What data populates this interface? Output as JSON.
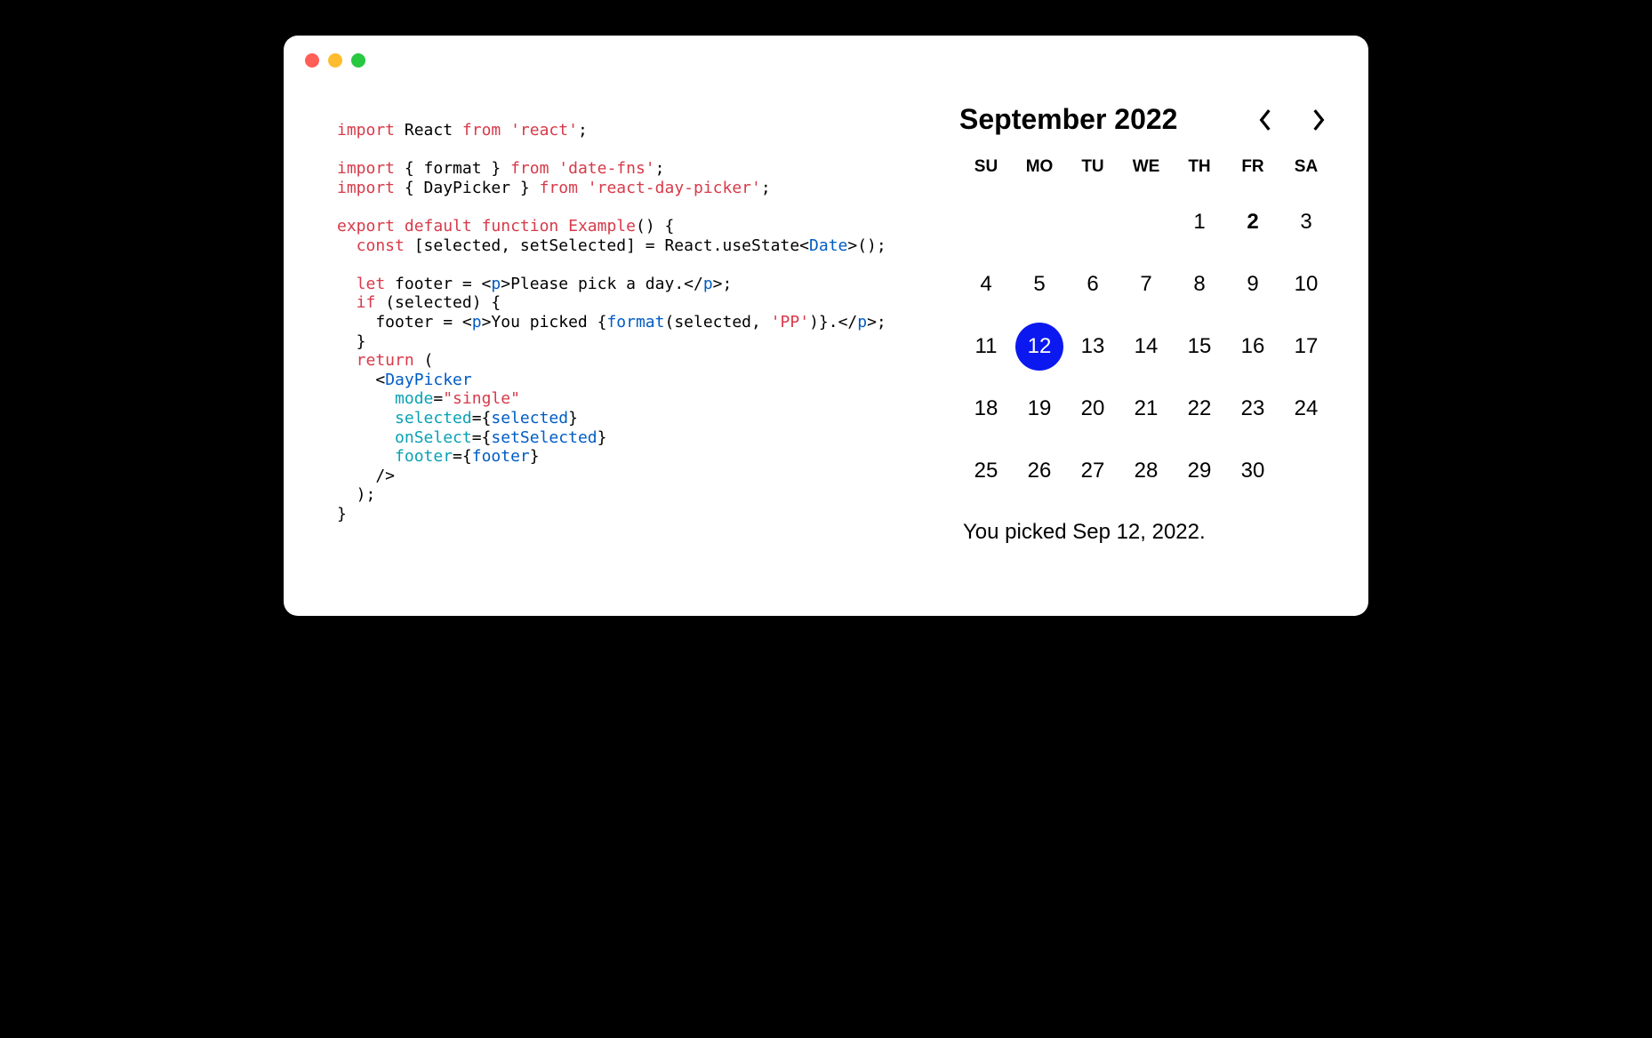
{
  "code": {
    "line1_import": "import",
    "line1_react": " React ",
    "line1_from": "from",
    "line1_str": " 'react'",
    "line1_end": ";",
    "line3_import": "import",
    "line3_mid": " { format } ",
    "line3_from": "from",
    "line3_str": " 'date-fns'",
    "line3_end": ";",
    "line4_import": "import",
    "line4_mid": " { DayPicker } ",
    "line4_from": "from",
    "line4_str": " 'react-day-picker'",
    "line4_end": ";",
    "line6_export": "export",
    "line6_default": " default",
    "line6_function": " function",
    "line6_name": " Example",
    "line6_end": "() {",
    "line7_a": "  const",
    "line7_b": " [selected, setSelected] = React.useState<",
    "line7_c": "Date",
    "line7_d": ">();",
    "line9_a": "  let",
    "line9_b": " footer = <",
    "line9_c": "p",
    "line9_d": ">Please pick a day.</",
    "line9_e": "p",
    "line9_f": ">;",
    "line10_a": "  if",
    "line10_b": " (selected) {",
    "line11_a": "    footer = <",
    "line11_b": "p",
    "line11_c": ">You picked {",
    "line11_d": "format",
    "line11_e": "(selected, ",
    "line11_f": "'PP'",
    "line11_g": ")}.</",
    "line11_h": "p",
    "line11_i": ">;",
    "line12": "  }",
    "line13_a": "  return",
    "line13_b": " (",
    "line14_a": "    <",
    "line14_b": "DayPicker",
    "line15_a": "      mode",
    "line15_b": "=",
    "line15_c": "\"single\"",
    "line16_a": "      selected",
    "line16_b": "={",
    "line16_c": "selected",
    "line16_d": "}",
    "line17_a": "      onSelect",
    "line17_b": "={",
    "line17_c": "setSelected",
    "line17_d": "}",
    "line18_a": "      footer",
    "line18_b": "={",
    "line18_c": "footer",
    "line18_d": "}",
    "line19": "    />",
    "line20": "  );",
    "line21": "}"
  },
  "calendar": {
    "title": "September 2022",
    "dow": [
      "SU",
      "MO",
      "TU",
      "WE",
      "TH",
      "FR",
      "SA"
    ],
    "weeks": [
      [
        "",
        "",
        "",
        "",
        "1",
        "2",
        "3"
      ],
      [
        "4",
        "5",
        "6",
        "7",
        "8",
        "9",
        "10"
      ],
      [
        "11",
        "12",
        "13",
        "14",
        "15",
        "16",
        "17"
      ],
      [
        "18",
        "19",
        "20",
        "21",
        "22",
        "23",
        "24"
      ],
      [
        "25",
        "26",
        "27",
        "28",
        "29",
        "30",
        ""
      ]
    ],
    "selected": "12",
    "today": "2",
    "footer": "You picked Sep 12, 2022."
  }
}
